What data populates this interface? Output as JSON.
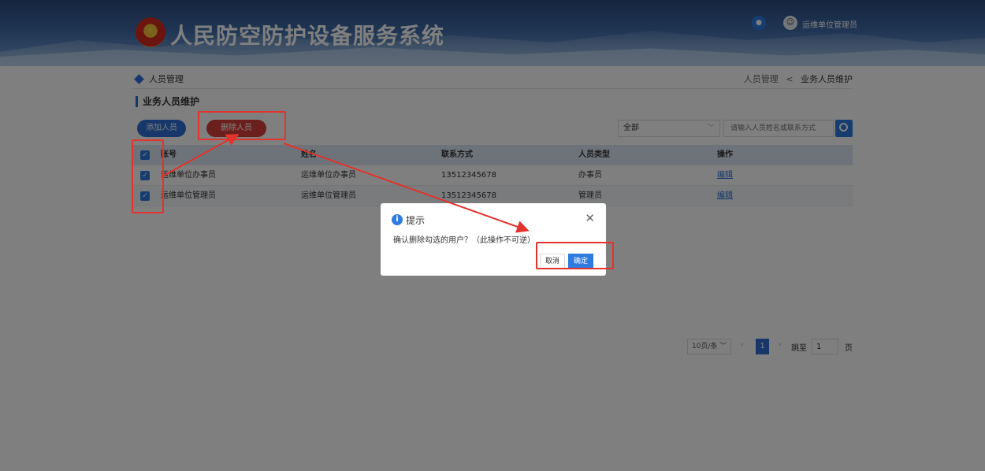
{
  "header": {
    "title": "人民防空防护设备服务系统",
    "user_name": "运维单位管理员"
  },
  "breadcrumb": {
    "left_label": "人员管理",
    "path_parent": "人员管理",
    "separator": "<",
    "path_current": "业务人员维护"
  },
  "section_title": "业务人员维护",
  "toolbar": {
    "add_label": "添加人员",
    "delete_label": "删除人员",
    "filter_value": "全部",
    "search_placeholder": "请输入人员姓名或联系方式"
  },
  "table": {
    "headers": [
      "账号",
      "姓名",
      "联系方式",
      "人员类型",
      "操作"
    ],
    "rows": [
      {
        "account": "运维单位办事员",
        "name": "运维单位办事员",
        "phone": "13512345678",
        "type": "办事员",
        "action": "编辑"
      },
      {
        "account": "运维单位管理员",
        "name": "运维单位管理员",
        "phone": "13512345678",
        "type": "管理员",
        "action": "编辑"
      }
    ]
  },
  "pagination": {
    "page_size": "10页/条",
    "current_page": "1",
    "goto_label": "跳至",
    "goto_value": "1",
    "unit": "页"
  },
  "dialog": {
    "title": "提示",
    "message": "确认删除勾选的用户？（此操作不可逆）",
    "cancel_label": "取消",
    "ok_label": "确定"
  },
  "colors": {
    "primary": "#2f6fd6",
    "danger": "#d9413b",
    "annotation": "#e2332c"
  },
  "icons": {
    "bell": "bell-icon",
    "avatar": "user-avatar-icon",
    "search": "search-icon",
    "info": "info-icon",
    "close": "close-icon",
    "emblem": "national-emblem-icon"
  }
}
